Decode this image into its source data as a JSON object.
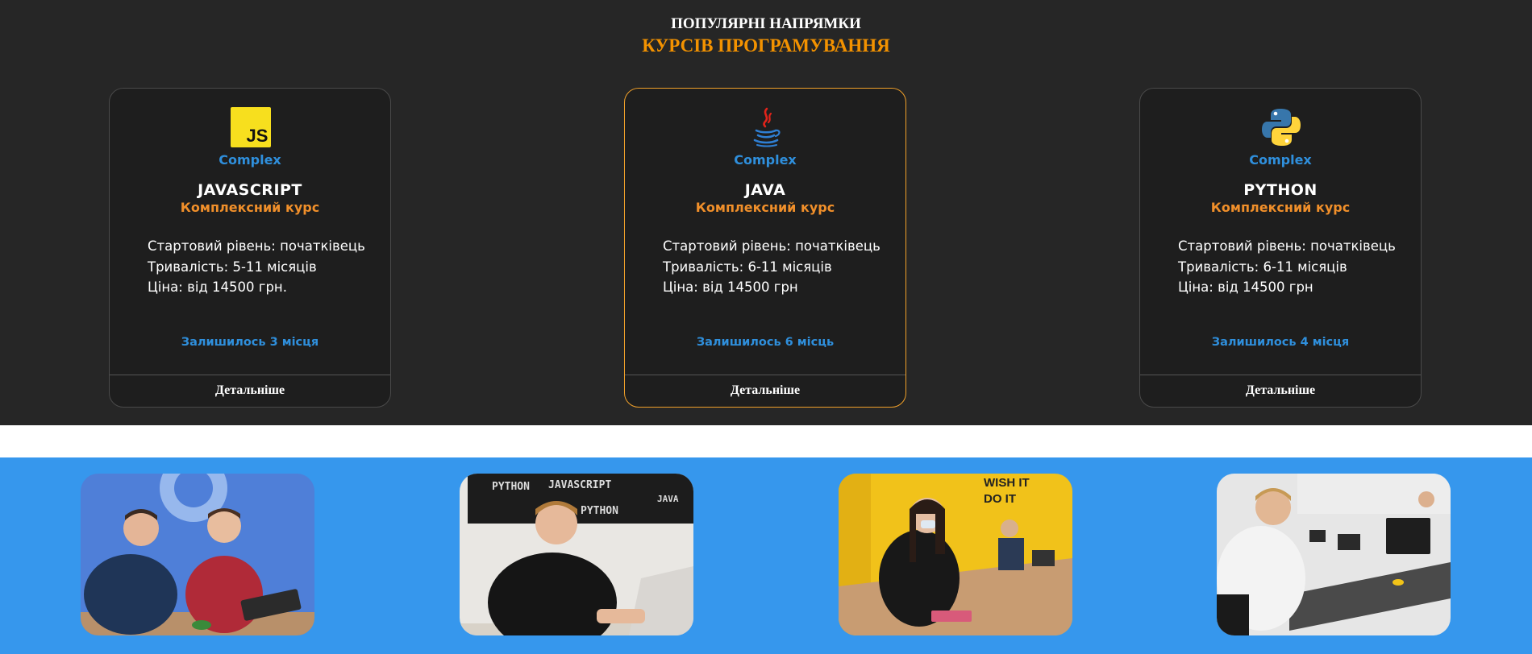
{
  "heading": {
    "line1": "ПОПУЛЯРНІ НАПРЯМКИ",
    "line2": "КУРСІВ ПРОГРАМУВАННЯ"
  },
  "courses": [
    {
      "icon": "javascript-logo-icon",
      "logo_text": "JS",
      "tag": "Complex",
      "name": "JAVASCRIPT",
      "subtitle": "Комплексний курс",
      "level": "Стартовий рівень: початківець",
      "duration": "Тривалість: 5-11 місяців",
      "price": "Ціна: від 14500 грн.",
      "seats": "Залишилось 3 місця",
      "details_label": "Детальніше"
    },
    {
      "icon": "java-logo-icon",
      "tag": "Complex",
      "name": "JAVA",
      "subtitle": "Комплексний курс",
      "level": "Стартовий рівень: початківець",
      "duration": "Тривалість: 6-11 місяців",
      "price": "Ціна: від 14500 грн",
      "seats": "Залишилось 6 місць",
      "details_label": "Детальніше"
    },
    {
      "icon": "python-logo-icon",
      "tag": "Complex",
      "name": "PYTHON",
      "subtitle": "Комплексний курс",
      "level": "Стартовий рівень: початківець",
      "duration": "Тривалість: 6-11 місяців",
      "price": "Ціна: від 14500 грн",
      "seats": "Залишилось 4 місця",
      "details_label": "Детальніше"
    }
  ],
  "photos": [
    {
      "name": "students-photo-1",
      "wall_text": ""
    },
    {
      "name": "students-photo-2",
      "wall_text": "PYTHON JAVASCRIPT JAVA"
    },
    {
      "name": "students-photo-3",
      "wall_text": "WISH IT DO IT"
    },
    {
      "name": "students-photo-4",
      "wall_text": ""
    }
  ],
  "colors": {
    "section_bg": "#262626",
    "card_bg": "#1e1e1e",
    "accent_orange": "#f39200",
    "accent_blue": "#2f8fdc",
    "photo_strip_bg": "#3697ed"
  }
}
